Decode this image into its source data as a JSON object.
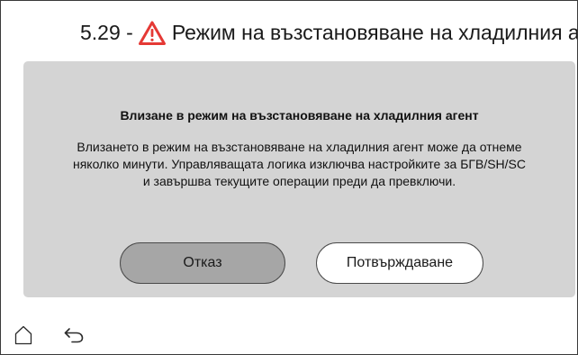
{
  "header": {
    "prefix": "5.29 -",
    "title": "Режим на възстановяване на хладилния агент",
    "icon": "warning-triangle-icon",
    "icon_color": "#e53935"
  },
  "dialog": {
    "title": "Влизане в режим на възстановяване на хладилния агент",
    "body_lines": [
      "Влизането в режим на възстановяване на хладилния агент може да отнеме",
      "няколко минути. Управляващата логика изключва настройките за БГВ/SH/SC",
      "и завършва текущите операции преди да превключи."
    ],
    "cancel_label": "Отказ",
    "confirm_label": "Потвърждаване"
  },
  "nav": {
    "home_icon": "home-icon",
    "back_icon": "back-arrow-icon"
  }
}
